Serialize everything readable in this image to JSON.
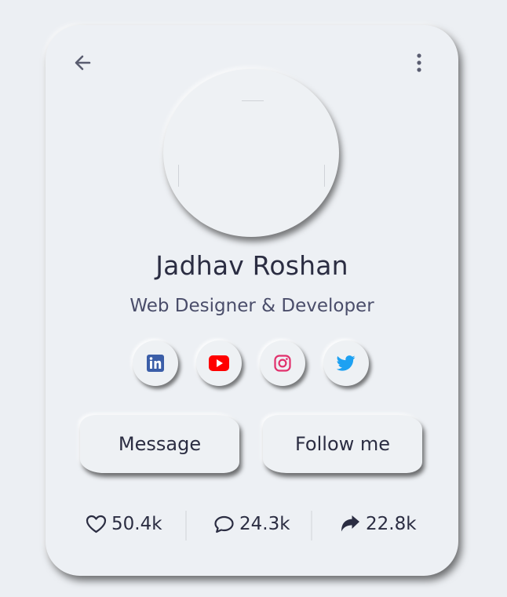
{
  "profile": {
    "name": "Jadhav Roshan",
    "role": "Web Designer & Developer"
  },
  "social": [
    {
      "icon": "linkedin-icon",
      "color": "#3b5ea8"
    },
    {
      "icon": "youtube-icon",
      "color": "#ff0000"
    },
    {
      "icon": "instagram-icon",
      "color": "#e1306c"
    },
    {
      "icon": "twitter-icon",
      "color": "#1da1f2"
    }
  ],
  "actions": {
    "message_label": "Message",
    "follow_label": "Follow me"
  },
  "stats": {
    "likes": "50.4k",
    "comments": "24.3k",
    "shares": "22.8k"
  },
  "icons": {
    "back": "arrow-left-icon",
    "menu": "more-vertical-icon",
    "likes": "heart-icon",
    "comments": "comment-icon",
    "shares": "share-icon"
  }
}
